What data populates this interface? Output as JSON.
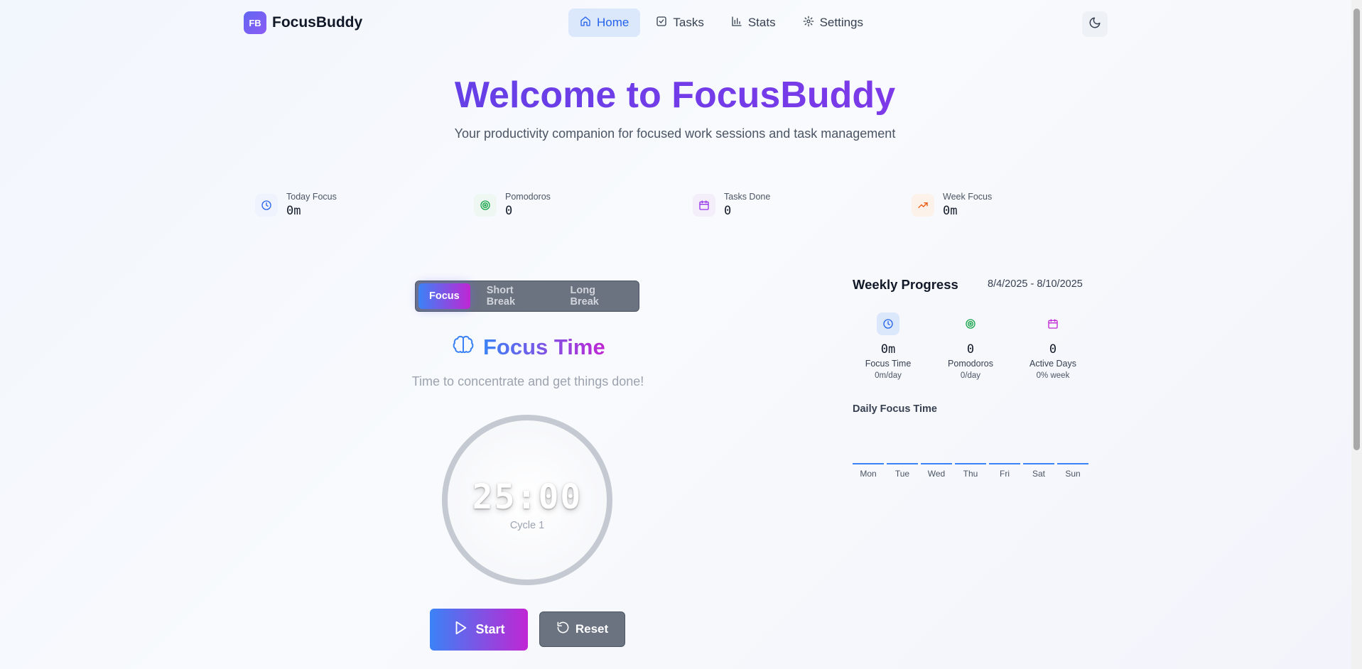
{
  "brand": {
    "badge": "FB",
    "name": "FocusBuddy"
  },
  "nav": [
    {
      "label": "Home",
      "icon": "home-icon",
      "active": true
    },
    {
      "label": "Tasks",
      "icon": "checkbox-icon"
    },
    {
      "label": "Stats",
      "icon": "bar-chart-icon"
    },
    {
      "label": "Settings",
      "icon": "gear-icon"
    }
  ],
  "theme_toggle": {
    "icon": "moon-icon"
  },
  "hero": {
    "title": "Welcome to FocusBuddy",
    "subtitle": "Your productivity companion for focused work sessions and task management"
  },
  "stats": [
    {
      "label": "Today Focus",
      "value": "0m",
      "icon": "clock-icon",
      "color": "#2563eb"
    },
    {
      "label": "Pomodoros",
      "value": "0",
      "icon": "target-icon",
      "color": "#16a34a"
    },
    {
      "label": "Tasks Done",
      "value": "0",
      "icon": "calendar-icon",
      "color": "#9333ea"
    },
    {
      "label": "Week Focus",
      "value": "0m",
      "icon": "trending-up-icon",
      "color": "#ea580c"
    }
  ],
  "timer": {
    "modes": [
      "Focus",
      "Short Break",
      "Long Break"
    ],
    "active_mode": "Focus",
    "title": "Focus Time",
    "title_icon": "brain-icon",
    "subtitle": "Time to concentrate and get things done!",
    "time": "25:00",
    "cycle": "Cycle 1",
    "start_label": "Start",
    "reset_label": "Reset"
  },
  "weekly": {
    "title": "Weekly Progress",
    "range": "8/4/2025 - 8/10/2025",
    "metrics": [
      {
        "value": "0m",
        "label": "Focus Time",
        "sub": "0m/day",
        "icon": "clock-icon"
      },
      {
        "value": "0",
        "label": "Pomodoros",
        "sub": "0/day",
        "icon": "target-icon"
      },
      {
        "value": "0",
        "label": "Active Days",
        "sub": "0% week",
        "icon": "calendar-icon"
      }
    ],
    "daily_title": "Daily Focus Time",
    "days": [
      "Mon",
      "Tue",
      "Wed",
      "Thu",
      "Fri",
      "Sat",
      "Sun"
    ]
  }
}
